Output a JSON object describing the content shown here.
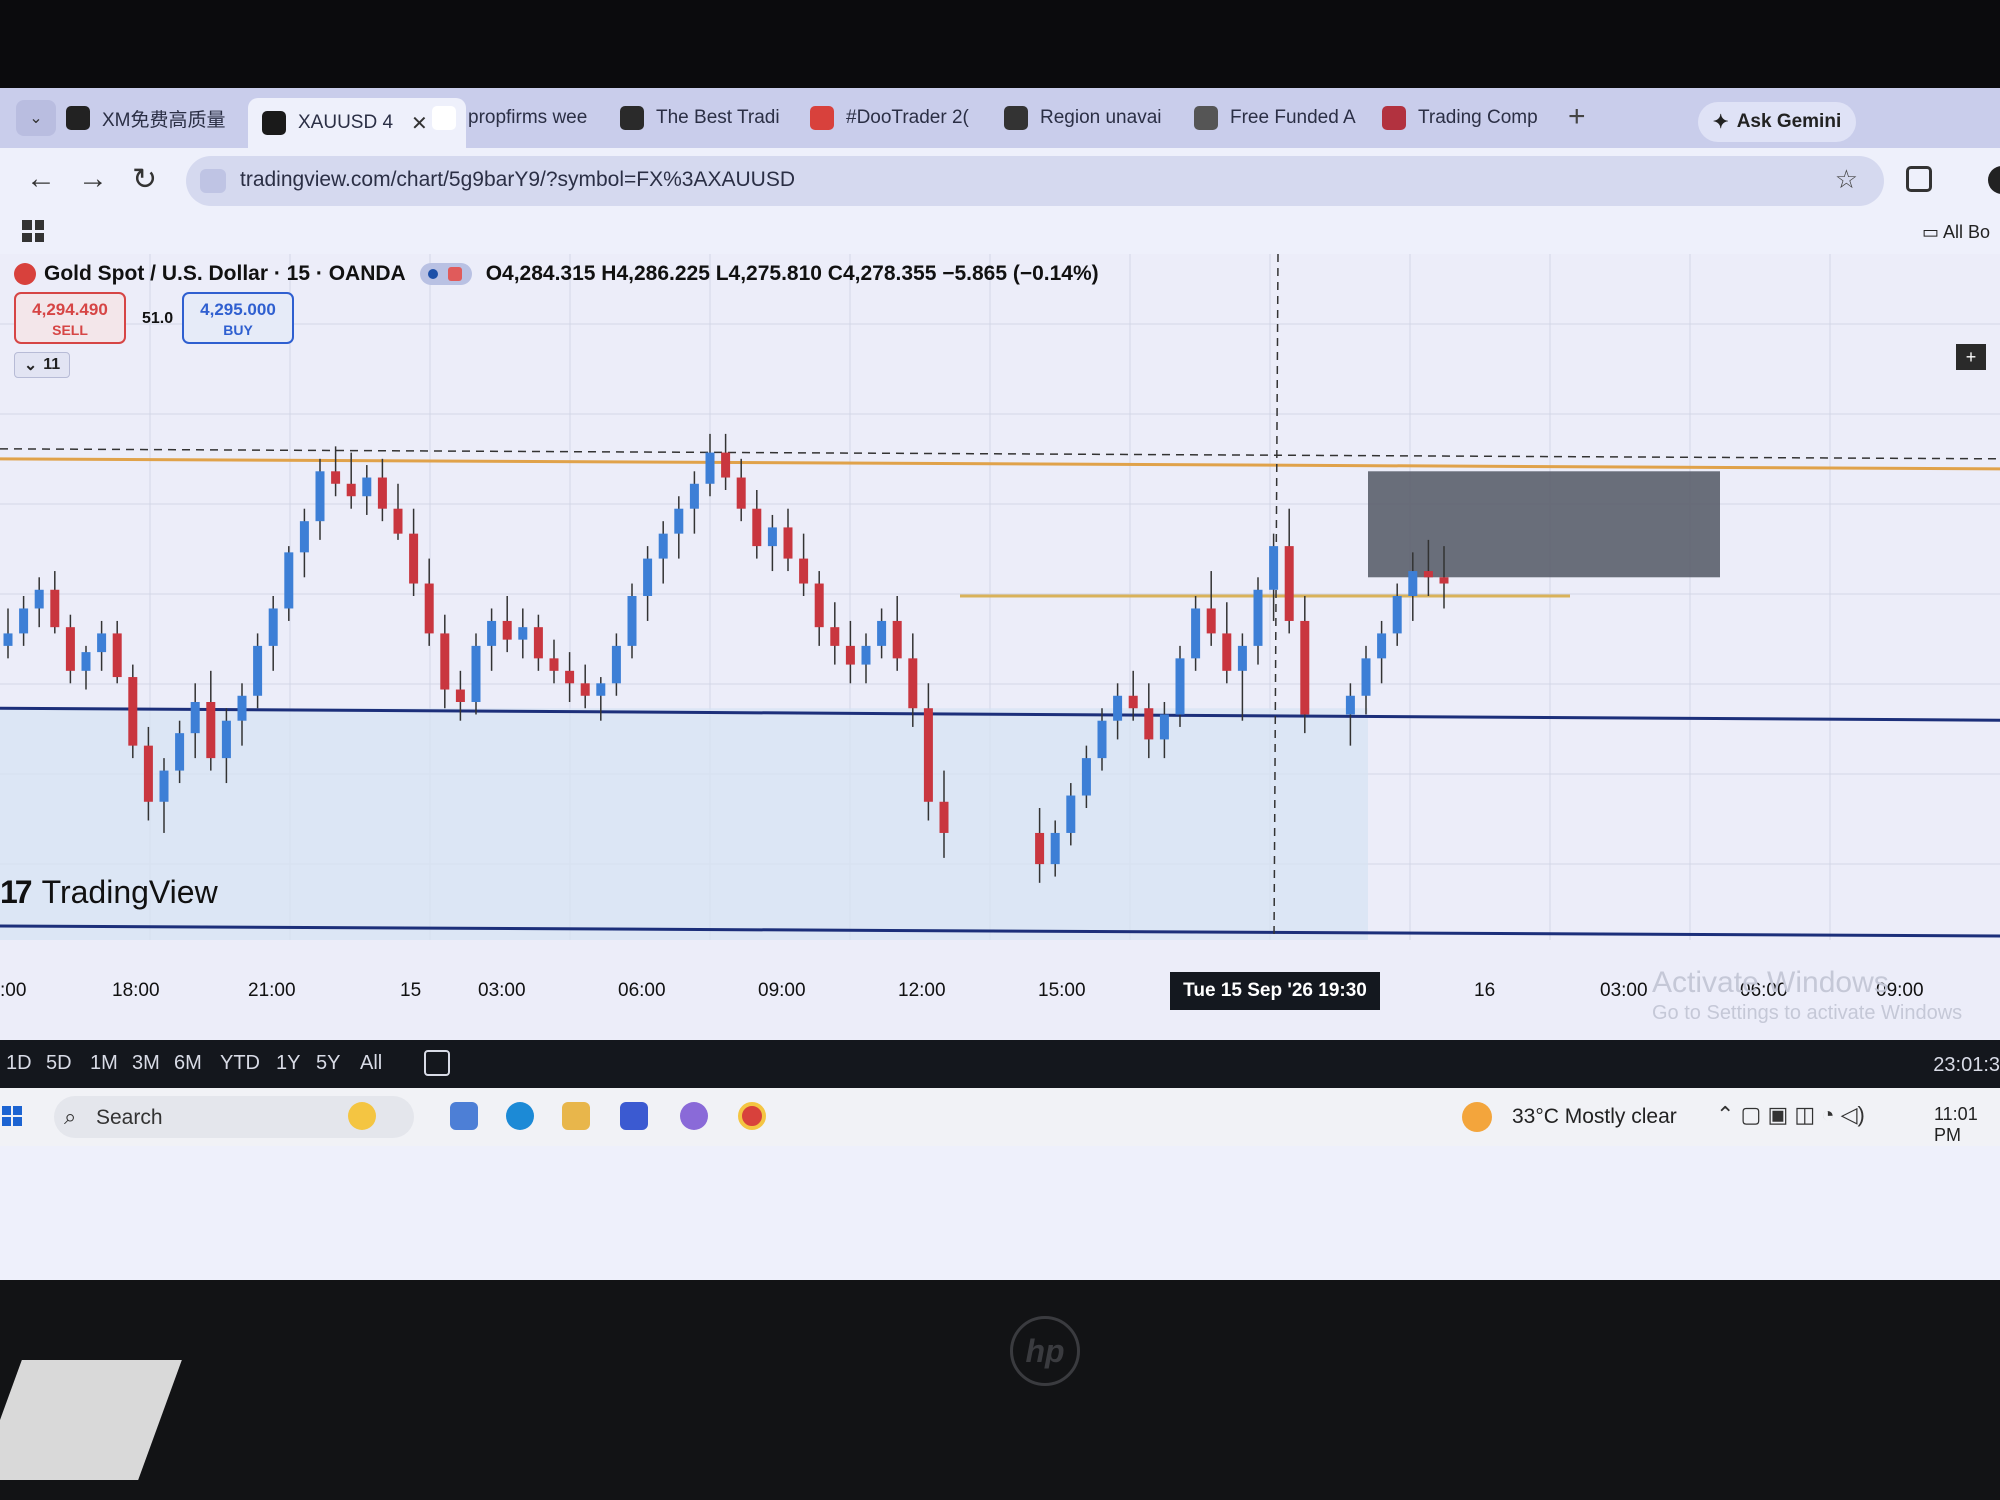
{
  "browser": {
    "tabs": [
      {
        "label": "XM免费高质量",
        "active": false,
        "fav_color": "#222222"
      },
      {
        "label": "XAUUSD 4",
        "active": true,
        "fav_color": "#1a1a1a"
      },
      {
        "label": "propfirms wee",
        "active": false,
        "fav_color": "#ffffff"
      },
      {
        "label": "The Best Tradi",
        "active": false,
        "fav_color": "#2a2a2a"
      },
      {
        "label": "#DooTrader 2(",
        "active": false,
        "fav_color": "#d8413c"
      },
      {
        "label": "Region unavai",
        "active": false,
        "fav_color": "#333333"
      },
      {
        "label": "Free Funded A",
        "active": false,
        "fav_color": "#555555"
      },
      {
        "label": "Trading Comp",
        "active": false,
        "fav_color": "#b2323f"
      }
    ],
    "new_tab": "+",
    "ask_gemini": "Ask Gemini",
    "url": "tradingview.com/chart/5g9barY9/?symbol=FX%3AXAUUSD",
    "bookmarks_all": "All Bo"
  },
  "chart": {
    "symbol": "Gold Spot / U.S. Dollar · 15 · OANDA",
    "ohlc": "O4,284.315 H4,286.225 L4,275.810 C4,278.355 −5.865 (−0.14%)",
    "sell_price": "4,294.490",
    "sell_label": "SELL",
    "spread": "51.0",
    "buy_price": "4,295.000",
    "buy_label": "BUY",
    "indicators_count": "11",
    "watermark": "TradingView",
    "plus_btn": "+"
  },
  "time_axis": {
    "ticks": [
      {
        "label": ":00"
      },
      {
        "label": "18:00"
      },
      {
        "label": "21:00"
      },
      {
        "label": "15"
      },
      {
        "label": "03:00"
      },
      {
        "label": "06:00"
      },
      {
        "label": "09:00"
      },
      {
        "label": "12:00"
      },
      {
        "label": "15:00"
      },
      {
        "label": "16"
      },
      {
        "label": "03:00"
      },
      {
        "label": "06:00"
      },
      {
        "label": "09:00"
      }
    ],
    "crosshair": "Tue 15 Sep '26   19:30"
  },
  "watermark_windows": {
    "line1": "Activate Windows",
    "line2": "Go to Settings to activate Windows"
  },
  "ranges": [
    "1D",
    "5D",
    "1M",
    "3M",
    "6M",
    "YTD",
    "1Y",
    "5Y",
    "All"
  ],
  "range_clock": "23:01:3",
  "taskbar": {
    "search": "Search",
    "weather": "33°C  Mostly clear",
    "time": "11:01 PM"
  },
  "colors": {
    "up": "#3d7fd6",
    "down": "#c9363f",
    "accent": "#2f5fd0"
  },
  "chart_data": {
    "type": "candlestick",
    "candles": [
      [
        4268,
        4274,
        4266,
        4270
      ],
      [
        4270,
        4276,
        4268,
        4274
      ],
      [
        4274,
        4279,
        4271,
        4277
      ],
      [
        4277,
        4280,
        4270,
        4271
      ],
      [
        4271,
        4273,
        4262,
        4264
      ],
      [
        4264,
        4268,
        4261,
        4267
      ],
      [
        4267,
        4272,
        4264,
        4270
      ],
      [
        4270,
        4272,
        4262,
        4263
      ],
      [
        4263,
        4265,
        4250,
        4252
      ],
      [
        4252,
        4255,
        4240,
        4243
      ],
      [
        4243,
        4250,
        4238,
        4248
      ],
      [
        4248,
        4256,
        4246,
        4254
      ],
      [
        4254,
        4262,
        4250,
        4259
      ],
      [
        4259,
        4264,
        4248,
        4250
      ],
      [
        4250,
        4258,
        4246,
        4256
      ],
      [
        4256,
        4262,
        4252,
        4260
      ],
      [
        4260,
        4270,
        4258,
        4268
      ],
      [
        4268,
        4276,
        4264,
        4274
      ],
      [
        4274,
        4284,
        4272,
        4283
      ],
      [
        4283,
        4290,
        4279,
        4288
      ],
      [
        4288,
        4298,
        4285,
        4296
      ],
      [
        4296,
        4300,
        4292,
        4294
      ],
      [
        4294,
        4299,
        4290,
        4292
      ],
      [
        4292,
        4297,
        4289,
        4295
      ],
      [
        4295,
        4298,
        4288,
        4290
      ],
      [
        4290,
        4294,
        4285,
        4286
      ],
      [
        4286,
        4290,
        4276,
        4278
      ],
      [
        4278,
        4282,
        4268,
        4270
      ],
      [
        4270,
        4273,
        4258,
        4261
      ],
      [
        4261,
        4264,
        4256,
        4259
      ],
      [
        4259,
        4270,
        4257,
        4268
      ],
      [
        4268,
        4274,
        4264,
        4272
      ],
      [
        4272,
        4276,
        4267,
        4269
      ],
      [
        4269,
        4274,
        4266,
        4271
      ],
      [
        4271,
        4273,
        4264,
        4266
      ],
      [
        4266,
        4269,
        4262,
        4264
      ],
      [
        4264,
        4267,
        4259,
        4262
      ],
      [
        4262,
        4265,
        4258,
        4260
      ],
      [
        4260,
        4263,
        4256,
        4262
      ],
      [
        4262,
        4270,
        4260,
        4268
      ],
      [
        4268,
        4278,
        4266,
        4276
      ],
      [
        4276,
        4284,
        4272,
        4282
      ],
      [
        4282,
        4288,
        4278,
        4286
      ],
      [
        4286,
        4292,
        4282,
        4290
      ],
      [
        4290,
        4296,
        4286,
        4294
      ],
      [
        4294,
        4302,
        4292,
        4299
      ],
      [
        4299,
        4302,
        4293,
        4295
      ],
      [
        4295,
        4298,
        4288,
        4290
      ],
      [
        4290,
        4293,
        4282,
        4284
      ],
      [
        4284,
        4289,
        4280,
        4287
      ],
      [
        4287,
        4290,
        4280,
        4282
      ],
      [
        4282,
        4286,
        4276,
        4278
      ],
      [
        4278,
        4280,
        4268,
        4271
      ],
      [
        4271,
        4275,
        4265,
        4268
      ],
      [
        4268,
        4272,
        4262,
        4265
      ],
      [
        4265,
        4270,
        4262,
        4268
      ],
      [
        4268,
        4274,
        4266,
        4272
      ],
      [
        4272,
        4276,
        4264,
        4266
      ],
      [
        4266,
        4270,
        4255,
        4258
      ],
      [
        4258,
        4262,
        4240,
        4243
      ],
      [
        4243,
        4248,
        4234,
        4238
      ],
      [
        4238,
        4242,
        4230,
        4233
      ],
      [
        4233,
        4240,
        4231,
        4238
      ],
      [
        4238,
        4246,
        4236,
        4244
      ],
      [
        4244,
        4252,
        4242,
        4250
      ],
      [
        4250,
        4258,
        4248,
        4256
      ],
      [
        4256,
        4262,
        4253,
        4260
      ],
      [
        4260,
        4264,
        4256,
        4258
      ],
      [
        4258,
        4262,
        4250,
        4253
      ],
      [
        4253,
        4259,
        4250,
        4257
      ],
      [
        4257,
        4268,
        4255,
        4266
      ],
      [
        4266,
        4276,
        4264,
        4274
      ],
      [
        4274,
        4280,
        4268,
        4270
      ],
      [
        4270,
        4275,
        4262,
        4264
      ],
      [
        4264,
        4270,
        4256,
        4268
      ],
      [
        4268,
        4279,
        4265,
        4277
      ],
      [
        4277,
        4286,
        4272,
        4284
      ],
      [
        4284,
        4290,
        4270,
        4272
      ],
      [
        4272,
        4276,
        4254,
        4257
      ],
      [
        4257,
        4262,
        4252,
        4260
      ],
      [
        4260,
        4268,
        4257,
        4266
      ],
      [
        4266,
        4272,
        4262,
        4270
      ],
      [
        4270,
        4278,
        4268,
        4276
      ],
      [
        4276,
        4283,
        4272,
        4280
      ],
      [
        4280,
        4285,
        4276,
        4279
      ],
      [
        4279,
        4284,
        4274,
        4278
      ]
    ],
    "ylim": [
      4225,
      4310
    ],
    "levels": {
      "resistance": 4298,
      "support": 4258,
      "minor": 4276
    },
    "position": {
      "entry": 4279,
      "stop": 4296,
      "target": 4224
    }
  }
}
